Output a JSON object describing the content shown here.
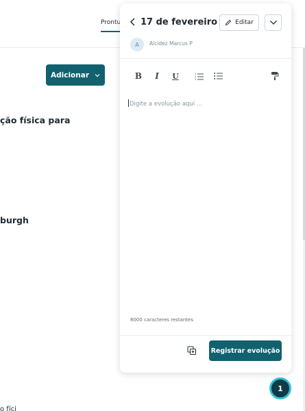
{
  "background": {
    "tab_label": "Prontua",
    "add_button_label": "Adicionar",
    "text_1": "ção física para",
    "text_2": "burgh",
    "text_3": "o fíci"
  },
  "panel": {
    "title": "17 de fevereiro",
    "edit_label": "Editar",
    "author_initial": "A",
    "author_name": "Alcidez Marcus P",
    "toolbar": {
      "bold": "B",
      "italic": "I",
      "underline": "U",
      "ordered_list_icon": "ordered-list-icon",
      "bullet_list_icon": "bullet-list-icon",
      "paint_icon": "paint-roller-icon"
    },
    "editor_placeholder": "Digite a evolução aqui ...",
    "remaining_chars": "8000 caracteres restantes",
    "submit_label": "Registrar evolução"
  },
  "notification": {
    "count": "1"
  },
  "colors": {
    "primary": "#12616f",
    "badge_bg": "#0f3a48",
    "badge_ring": "#34c1cf"
  }
}
